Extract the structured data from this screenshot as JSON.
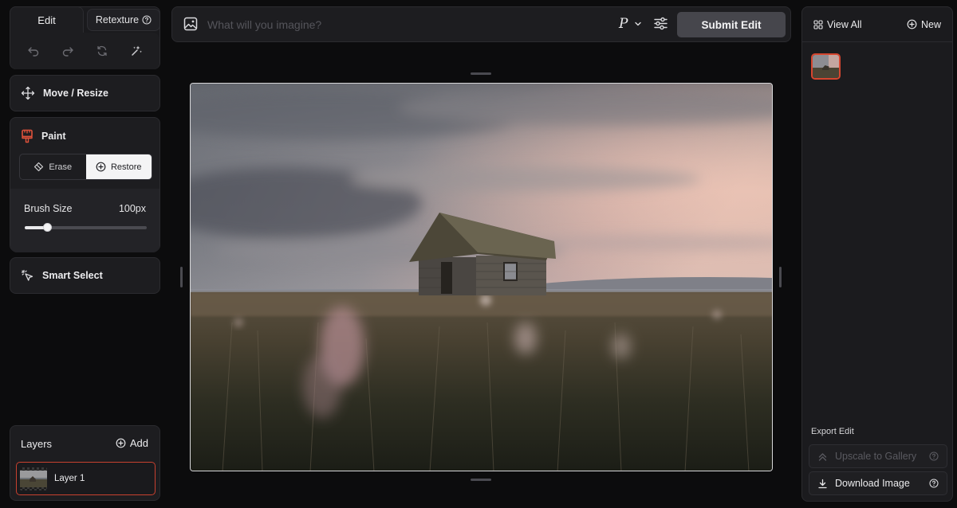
{
  "tabs": {
    "edit_label": "Edit",
    "retexture_label": "Retexture"
  },
  "tools": {
    "move_label": "Move / Resize",
    "paint_label": "Paint",
    "erase_label": "Erase",
    "restore_label": "Restore",
    "smart_select_label": "Smart Select"
  },
  "brush": {
    "label": "Brush Size",
    "value_text": "100px",
    "level": 0.18
  },
  "layers": {
    "title": "Layers",
    "add_label": "Add",
    "items": [
      {
        "name": "Layer 1"
      }
    ]
  },
  "prompt": {
    "placeholder": "What will you imagine?",
    "value": "",
    "style_glyph": "P",
    "submit_label": "Submit Edit"
  },
  "gallery": {
    "view_all_label": "View All",
    "new_label": "New"
  },
  "export": {
    "title": "Export Edit",
    "upscale_label": "Upscale to Gallery",
    "download_label": "Download Image"
  },
  "colors": {
    "accent": "#d6462f",
    "panel_bg": "#1d1d20",
    "page_bg": "#0c0c0d",
    "submit_bg": "#46464c"
  },
  "icons": {
    "undo": "undo-icon",
    "redo": "redo-icon",
    "reset": "reset-icon",
    "magic": "magic-wand-icon",
    "move": "move-arrows-icon",
    "paint": "paint-brush-icon",
    "erase": "eraser-icon",
    "restore": "plus-circle-icon",
    "smart_select": "cursor-sparkle-icon",
    "image": "image-icon",
    "settings": "sliders-icon",
    "grid": "grid-icon",
    "upscale": "upscale-icon",
    "download": "download-icon",
    "help": "help-circle-icon"
  }
}
